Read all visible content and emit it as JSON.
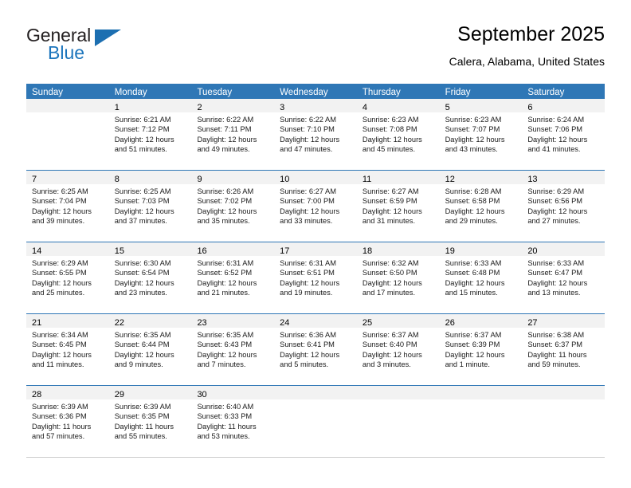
{
  "logo": {
    "word_one": "General",
    "word_two": "Blue",
    "triangle_color": "#1c6fb1",
    "blue_color": "#1c75bc"
  },
  "header": {
    "title": "September 2025",
    "subtitle": "Calera, Alabama, United States"
  },
  "theme": {
    "header_blue": "#2f77b6",
    "day_band_gray": "#f2f2f2",
    "text": "#1a1a1a"
  },
  "day_headers": [
    "Sunday",
    "Monday",
    "Tuesday",
    "Wednesday",
    "Thursday",
    "Friday",
    "Saturday"
  ],
  "weeks": [
    [
      {
        "day": "",
        "lines": []
      },
      {
        "day": "1",
        "lines": [
          "Sunrise: 6:21 AM",
          "Sunset: 7:12 PM",
          "Daylight: 12 hours",
          "and 51 minutes."
        ]
      },
      {
        "day": "2",
        "lines": [
          "Sunrise: 6:22 AM",
          "Sunset: 7:11 PM",
          "Daylight: 12 hours",
          "and 49 minutes."
        ]
      },
      {
        "day": "3",
        "lines": [
          "Sunrise: 6:22 AM",
          "Sunset: 7:10 PM",
          "Daylight: 12 hours",
          "and 47 minutes."
        ]
      },
      {
        "day": "4",
        "lines": [
          "Sunrise: 6:23 AM",
          "Sunset: 7:08 PM",
          "Daylight: 12 hours",
          "and 45 minutes."
        ]
      },
      {
        "day": "5",
        "lines": [
          "Sunrise: 6:23 AM",
          "Sunset: 7:07 PM",
          "Daylight: 12 hours",
          "and 43 minutes."
        ]
      },
      {
        "day": "6",
        "lines": [
          "Sunrise: 6:24 AM",
          "Sunset: 7:06 PM",
          "Daylight: 12 hours",
          "and 41 minutes."
        ]
      }
    ],
    [
      {
        "day": "7",
        "lines": [
          "Sunrise: 6:25 AM",
          "Sunset: 7:04 PM",
          "Daylight: 12 hours",
          "and 39 minutes."
        ]
      },
      {
        "day": "8",
        "lines": [
          "Sunrise: 6:25 AM",
          "Sunset: 7:03 PM",
          "Daylight: 12 hours",
          "and 37 minutes."
        ]
      },
      {
        "day": "9",
        "lines": [
          "Sunrise: 6:26 AM",
          "Sunset: 7:02 PM",
          "Daylight: 12 hours",
          "and 35 minutes."
        ]
      },
      {
        "day": "10",
        "lines": [
          "Sunrise: 6:27 AM",
          "Sunset: 7:00 PM",
          "Daylight: 12 hours",
          "and 33 minutes."
        ]
      },
      {
        "day": "11",
        "lines": [
          "Sunrise: 6:27 AM",
          "Sunset: 6:59 PM",
          "Daylight: 12 hours",
          "and 31 minutes."
        ]
      },
      {
        "day": "12",
        "lines": [
          "Sunrise: 6:28 AM",
          "Sunset: 6:58 PM",
          "Daylight: 12 hours",
          "and 29 minutes."
        ]
      },
      {
        "day": "13",
        "lines": [
          "Sunrise: 6:29 AM",
          "Sunset: 6:56 PM",
          "Daylight: 12 hours",
          "and 27 minutes."
        ]
      }
    ],
    [
      {
        "day": "14",
        "lines": [
          "Sunrise: 6:29 AM",
          "Sunset: 6:55 PM",
          "Daylight: 12 hours",
          "and 25 minutes."
        ]
      },
      {
        "day": "15",
        "lines": [
          "Sunrise: 6:30 AM",
          "Sunset: 6:54 PM",
          "Daylight: 12 hours",
          "and 23 minutes."
        ]
      },
      {
        "day": "16",
        "lines": [
          "Sunrise: 6:31 AM",
          "Sunset: 6:52 PM",
          "Daylight: 12 hours",
          "and 21 minutes."
        ]
      },
      {
        "day": "17",
        "lines": [
          "Sunrise: 6:31 AM",
          "Sunset: 6:51 PM",
          "Daylight: 12 hours",
          "and 19 minutes."
        ]
      },
      {
        "day": "18",
        "lines": [
          "Sunrise: 6:32 AM",
          "Sunset: 6:50 PM",
          "Daylight: 12 hours",
          "and 17 minutes."
        ]
      },
      {
        "day": "19",
        "lines": [
          "Sunrise: 6:33 AM",
          "Sunset: 6:48 PM",
          "Daylight: 12 hours",
          "and 15 minutes."
        ]
      },
      {
        "day": "20",
        "lines": [
          "Sunrise: 6:33 AM",
          "Sunset: 6:47 PM",
          "Daylight: 12 hours",
          "and 13 minutes."
        ]
      }
    ],
    [
      {
        "day": "21",
        "lines": [
          "Sunrise: 6:34 AM",
          "Sunset: 6:45 PM",
          "Daylight: 12 hours",
          "and 11 minutes."
        ]
      },
      {
        "day": "22",
        "lines": [
          "Sunrise: 6:35 AM",
          "Sunset: 6:44 PM",
          "Daylight: 12 hours",
          "and 9 minutes."
        ]
      },
      {
        "day": "23",
        "lines": [
          "Sunrise: 6:35 AM",
          "Sunset: 6:43 PM",
          "Daylight: 12 hours",
          "and 7 minutes."
        ]
      },
      {
        "day": "24",
        "lines": [
          "Sunrise: 6:36 AM",
          "Sunset: 6:41 PM",
          "Daylight: 12 hours",
          "and 5 minutes."
        ]
      },
      {
        "day": "25",
        "lines": [
          "Sunrise: 6:37 AM",
          "Sunset: 6:40 PM",
          "Daylight: 12 hours",
          "and 3 minutes."
        ]
      },
      {
        "day": "26",
        "lines": [
          "Sunrise: 6:37 AM",
          "Sunset: 6:39 PM",
          "Daylight: 12 hours",
          "and 1 minute."
        ]
      },
      {
        "day": "27",
        "lines": [
          "Sunrise: 6:38 AM",
          "Sunset: 6:37 PM",
          "Daylight: 11 hours",
          "and 59 minutes."
        ]
      }
    ],
    [
      {
        "day": "28",
        "lines": [
          "Sunrise: 6:39 AM",
          "Sunset: 6:36 PM",
          "Daylight: 11 hours",
          "and 57 minutes."
        ]
      },
      {
        "day": "29",
        "lines": [
          "Sunrise: 6:39 AM",
          "Sunset: 6:35 PM",
          "Daylight: 11 hours",
          "and 55 minutes."
        ]
      },
      {
        "day": "30",
        "lines": [
          "Sunrise: 6:40 AM",
          "Sunset: 6:33 PM",
          "Daylight: 11 hours",
          "and 53 minutes."
        ]
      },
      {
        "day": "",
        "lines": []
      },
      {
        "day": "",
        "lines": []
      },
      {
        "day": "",
        "lines": []
      },
      {
        "day": "",
        "lines": []
      }
    ]
  ]
}
